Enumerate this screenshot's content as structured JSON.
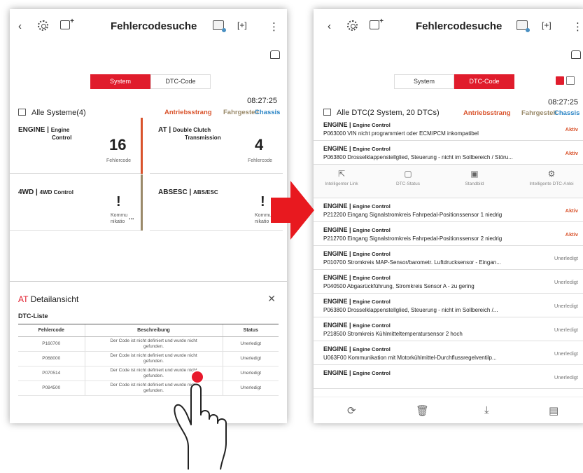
{
  "app": {
    "title": "Fehlercodesuche"
  },
  "colors": {
    "accent": "#e01c2c",
    "antrieb": "#d9532c",
    "fahrgestell": "#9a8a6a",
    "chassis": "#2d86c6"
  },
  "left": {
    "tabs": [
      {
        "label": "System",
        "active": true
      },
      {
        "label": "DTC-Code",
        "active": false
      }
    ],
    "time": "08:27:25",
    "systems_label": "Alle Systeme(4)",
    "categories": [
      "Antriebsstrang",
      "Fahrgestell",
      "Chassis"
    ],
    "cards": [
      {
        "name": "ENGINE",
        "sub1": "Engine",
        "sub2": "Control",
        "count": "16",
        "count_label": "Fehlercode"
      },
      {
        "name": "AT",
        "sub1": "Double Clutch",
        "sub2": "Transmission",
        "count": "4",
        "count_label": "Fehlercode"
      },
      {
        "name": "4WD",
        "sub1": "4WD Control",
        "mark": "!",
        "kom1": "Kommu",
        "kom2": "nikatio",
        "dots": "..."
      },
      {
        "name": "ABSESC",
        "sub1": "ABS/ESC",
        "mark": "!",
        "kom1": "Kommu",
        "kom2": "nikatio",
        "dots": "..."
      }
    ],
    "detail": {
      "title_prefix": "AT",
      "title": "Detailansicht",
      "sub": "DTC-Liste",
      "headers": [
        "Fehlercode",
        "Beschreibung",
        "Status"
      ],
      "rows": [
        {
          "code": "P160700",
          "desc1": "Der Code ist nicht definiert und wurde nicht",
          "desc2": "gefunden.",
          "status": "Unerledigt"
        },
        {
          "code": "P068000",
          "desc1": "Der Code ist nicht definiert und wurde nicht",
          "desc2": "gefunden.",
          "status": "Unerledigt"
        },
        {
          "code": "P070514",
          "desc1": "Der Code ist nicht definiert und wurde nicht",
          "desc2": "gefunden.",
          "status": "Unerledigt"
        },
        {
          "code": "P084500",
          "desc1": "Der Code ist nicht definiert und wurde nicht",
          "desc2": "gefunden.",
          "status": "Unerledigt"
        }
      ]
    }
  },
  "right": {
    "tabs": [
      {
        "label": "System",
        "active": false
      },
      {
        "label": "DTC-Code",
        "active": true
      }
    ],
    "time": "08:27:25",
    "summary": "Alle DTC(2 System, 20 DTCs)",
    "categories": [
      "Antriebsstrang",
      "Fahrgestell",
      "Chassis"
    ],
    "rows": [
      {
        "sys": "ENGINE",
        "sub": "Engine Control",
        "desc": "P063000 VIN nicht programmiert oder ECM/PCM inkompatibel",
        "status": "Aktiv"
      },
      {
        "sys": "ENGINE",
        "sub": "Engine Control",
        "desc": "P063800 Drosselklappenstellglied, Steuerung - nicht im Sollbereich / Störu...",
        "status": "Aktiv"
      },
      {
        "sys": "ENGINE",
        "sub": "Engine Control",
        "desc": "P212200 Eingang Signalstromkreis Fahrpedal-Positionssensor 1 niedrig",
        "status": "Aktiv"
      },
      {
        "sys": "ENGINE",
        "sub": "Engine Control",
        "desc": "P212700 Eingang Signalstromkreis Fahrpedal-Positionssensor 2 niedrig",
        "status": "Aktiv"
      },
      {
        "sys": "ENGINE",
        "sub": "Engine Control",
        "desc": "P010700 Stromkreis MAP-Sensor/barometr. Luftdrucksensor - Eingan...",
        "status": "Unerledigt"
      },
      {
        "sys": "ENGINE",
        "sub": "Engine Control",
        "desc": "P040500 Abgasrückführung, Stromkreis Sensor A - zu gering",
        "status": "Unerledigt"
      },
      {
        "sys": "ENGINE",
        "sub": "Engine Control",
        "desc": "P063800 Drosselklappenstellglied, Steuerung - nicht im Sollbereich /...",
        "status": "Unerledigt"
      },
      {
        "sys": "ENGINE",
        "sub": "Engine Control",
        "desc": "P218500 Stromkreis Kühlmitteltemperatursensor 2 hoch",
        "status": "Unerledigt"
      },
      {
        "sys": "ENGINE",
        "sub": "Engine Control",
        "desc": "U063F00 Kommunikation mit Motorkühlmittel-Durchflussregelventilp...",
        "status": "Unerledigt"
      },
      {
        "sys": "ENGINE",
        "sub": "Engine Control",
        "desc": "",
        "status": "Unerledigt"
      }
    ],
    "actions": [
      "Intelligenter Link",
      "DTC-Status",
      "Standbild",
      "Intelligente DTC-Anlei"
    ]
  }
}
